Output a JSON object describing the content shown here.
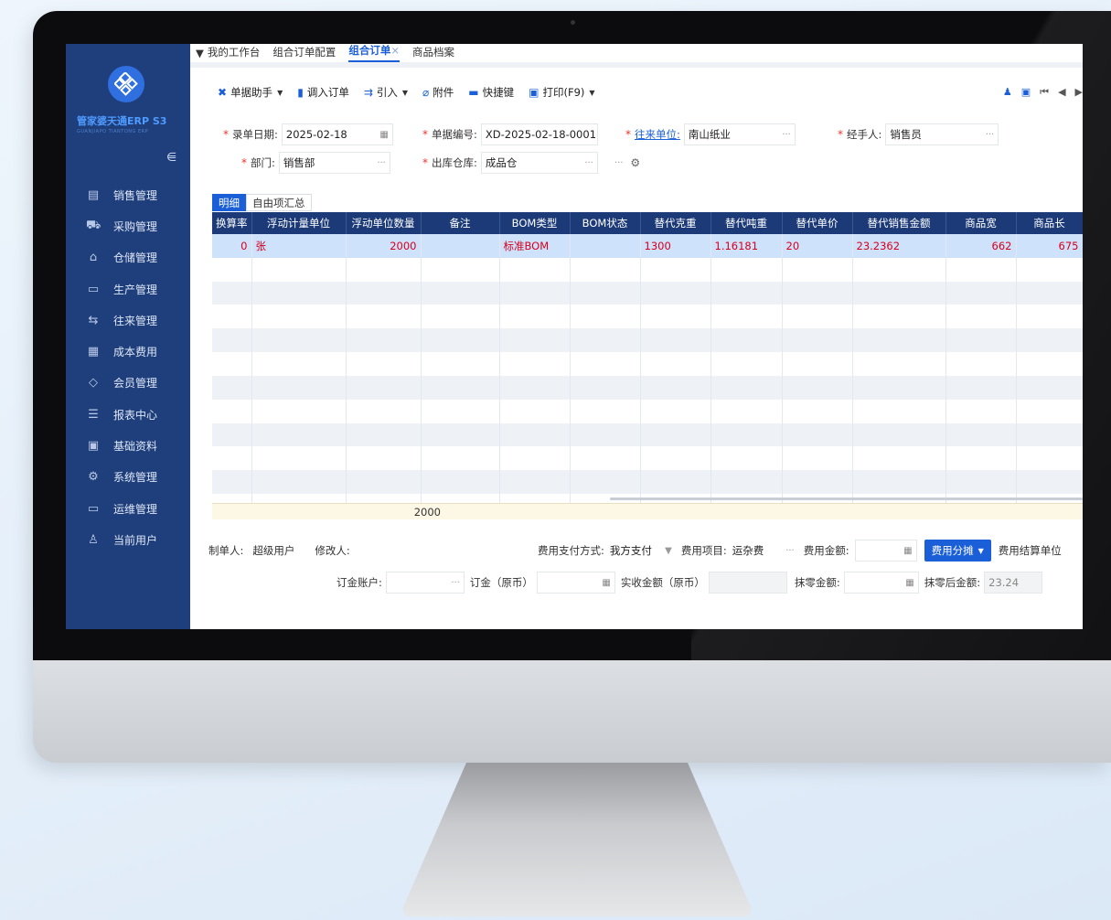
{
  "sidebar": {
    "brand": "管家婆天通ERP S3",
    "brand_sub": "GUANJIAPO TIANTONG ERP",
    "items": [
      {
        "label": "销售管理",
        "icon": "sales-doc-icon"
      },
      {
        "label": "采购管理",
        "icon": "cart-icon"
      },
      {
        "label": "仓储管理",
        "icon": "warehouse-icon"
      },
      {
        "label": "生产管理",
        "icon": "factory-icon"
      },
      {
        "label": "往来管理",
        "icon": "exchange-icon"
      },
      {
        "label": "成本费用",
        "icon": "calculator-icon"
      },
      {
        "label": "会员管理",
        "icon": "diamond-icon"
      },
      {
        "label": "报表中心",
        "icon": "report-icon"
      },
      {
        "label": "基础资料",
        "icon": "id-card-icon"
      },
      {
        "label": "系统管理",
        "icon": "gear-icon"
      },
      {
        "label": "运维管理",
        "icon": "monitor-icon"
      },
      {
        "label": "当前用户",
        "icon": "user-icon"
      }
    ]
  },
  "tabs": [
    {
      "label": "我的工作台"
    },
    {
      "label": "组合订单配置"
    },
    {
      "label": "组合订单",
      "close": "×"
    },
    {
      "label": "商品档案"
    }
  ],
  "toolbar": {
    "assistant": "单据助手",
    "import_order": "调入订单",
    "import": "引入",
    "attachment": "附件",
    "shortcut": "快捷键",
    "print": "打印(F9)"
  },
  "form": {
    "date_label": "录单日期:",
    "date_value": "2025-02-18",
    "no_label": "单据编号:",
    "no_value": "XD-2025-02-18-0001",
    "partner_label": "往来单位:",
    "partner_value": "南山纸业",
    "handler_label": "经手人:",
    "handler_value": "销售员",
    "dept_label": "部门:",
    "dept_value": "销售部",
    "warehouse_label": "出库仓库:",
    "warehouse_value": "成品仓"
  },
  "detail_tabs": [
    "明细",
    "自由项汇总"
  ],
  "grid": {
    "columns": [
      "换算率",
      "浮动计量单位",
      "浮动单位数量",
      "备注",
      "BOM类型",
      "BOM状态",
      "替代克重",
      "替代吨重",
      "替代单价",
      "替代销售金额",
      "商品宽",
      "商品长"
    ],
    "rows": [
      [
        "0",
        "张",
        "2000",
        "",
        "标准BOM",
        "",
        "1300",
        "1.16181",
        "20",
        "23.2362",
        "662",
        "675"
      ]
    ],
    "total_qty": "2000"
  },
  "footer": {
    "creator_label": "制单人:",
    "creator_value": "超级用户",
    "modifier_label": "修改人:",
    "pay_method_label": "费用支付方式:",
    "pay_method_value": "我方支付",
    "fee_item_label": "费用项目:",
    "fee_item_value": "运杂费",
    "fee_amount_label": "费用金额:",
    "fee_split_button": "费用分摊",
    "fee_settle_label": "费用结算单位",
    "deposit_account_label": "订金账户:",
    "deposit_label": "订金（原币）",
    "received_label": "实收金额（原币）",
    "rounding_label": "抹零金额:",
    "after_rounding_label": "抹零后金额:",
    "after_rounding_value": "23.24"
  },
  "colors": {
    "sidebar": "#1f3f7c",
    "accent": "#1a5fd8",
    "header": "#1c3a78"
  }
}
